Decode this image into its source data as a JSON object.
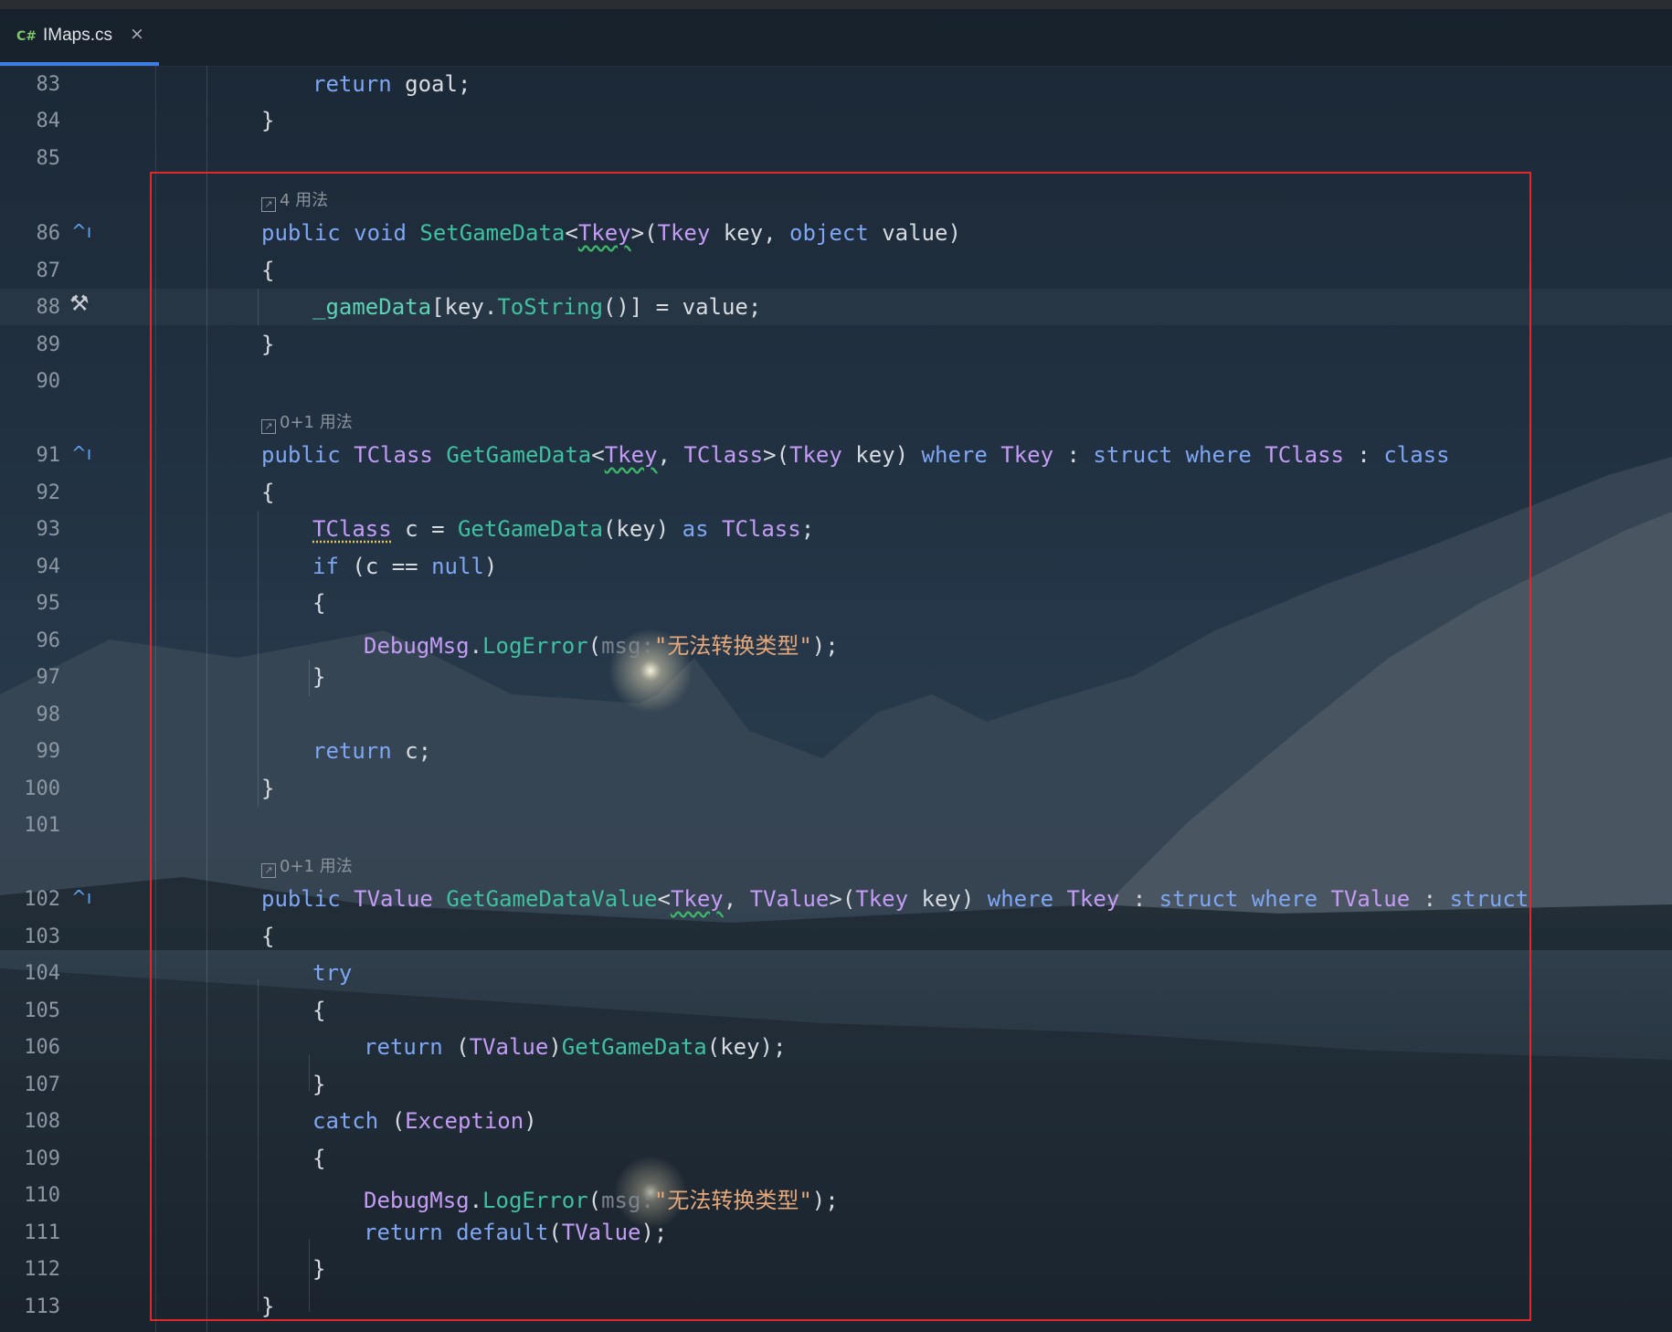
{
  "tab": {
    "icon": "C#",
    "filename": "IMaps.cs",
    "close": "×"
  },
  "lines": [
    {
      "n": "83"
    },
    {
      "n": "84"
    },
    {
      "n": "85"
    },
    {
      "n": "86"
    },
    {
      "n": "87"
    },
    {
      "n": "88"
    },
    {
      "n": "89"
    },
    {
      "n": "90"
    },
    {
      "n": "91"
    },
    {
      "n": "92"
    },
    {
      "n": "93"
    },
    {
      "n": "94"
    },
    {
      "n": "95"
    },
    {
      "n": "96"
    },
    {
      "n": "97"
    },
    {
      "n": "98"
    },
    {
      "n": "99"
    },
    {
      "n": "100"
    },
    {
      "n": "101"
    },
    {
      "n": "102"
    },
    {
      "n": "103"
    },
    {
      "n": "104"
    },
    {
      "n": "105"
    },
    {
      "n": "106"
    },
    {
      "n": "107"
    },
    {
      "n": "108"
    },
    {
      "n": "109"
    },
    {
      "n": "110"
    },
    {
      "n": "111"
    },
    {
      "n": "112"
    },
    {
      "n": "113"
    }
  ],
  "hints": {
    "usages1": "4 用法",
    "usages2": "0+1 用法",
    "usages3": "0+1 用法"
  },
  "gutter_icons": {
    "override": "^ı",
    "build": "hammer-icon"
  },
  "tok": {
    "return": "return",
    "goal": "goal",
    "semi": ";",
    "rbrace": "}",
    "lbrace": "{",
    "public": "public",
    "void": "void",
    "SetGameData": "SetGameData",
    "lt": "<",
    "gt": ">",
    "Tkey": "Tkey",
    "lp": "(",
    "rp": ")",
    "key": "key",
    "comma": ",",
    "object": "object",
    "value": "value",
    "_gameData": "_gameData",
    "lb": "[",
    "rb": "]",
    "dot": ".",
    "ToString": "ToString",
    "parens": "()",
    "assign": "=",
    "TClass": "TClass",
    "GetGameData": "GetGameData",
    "where": "where",
    "colon": ":",
    "struct": "struct",
    "class": "class",
    "c": "c",
    "as": "as",
    "if": "if",
    "eqeq": "==",
    "null": "null",
    "DebugMsg": "DebugMsg",
    "LogError": "LogError",
    "msg": "msg:",
    "errstr": "\"无法转换类型\"",
    "TValue": "TValue",
    "GetGameDataValue": "GetGameDataValue",
    "try": "try",
    "catch": "catch",
    "Exception": "Exception",
    "default": "default"
  },
  "colors": {
    "keyword": "#7ea6f2",
    "type": "#c59cf5",
    "function": "#3fc1a0",
    "string": "#e6a87a",
    "highlight_box": "#e02828",
    "tab_underline": "#3d7ee6"
  }
}
